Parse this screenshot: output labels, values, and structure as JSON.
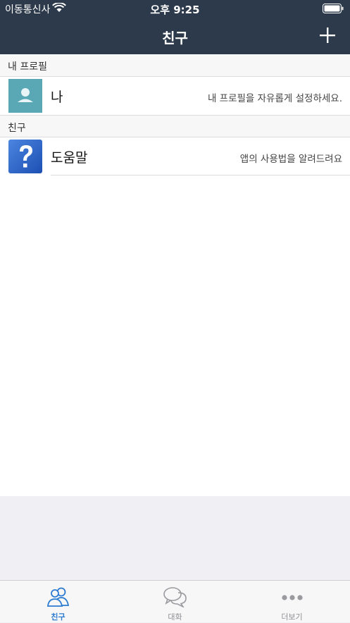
{
  "status_bar": {
    "carrier": "이동통신사",
    "time": "오후 9:25"
  },
  "nav": {
    "title": "친구",
    "add_icon": "plus-icon"
  },
  "sections": [
    {
      "header": "내 프로필"
    },
    {
      "header": "친구"
    }
  ],
  "my_profile": {
    "name": "나",
    "status": "내 프로필을 자유롭게 설정하세요.",
    "avatar_color": "#5aa7b5"
  },
  "friends": [
    {
      "name": "도움말",
      "status": "앱의 사용법을 알려드려요",
      "icon": "help-question-icon"
    }
  ],
  "tabs": [
    {
      "label": "친구",
      "icon": "friends-icon",
      "active": true
    },
    {
      "label": "대화",
      "icon": "chat-bubbles-icon",
      "active": false
    },
    {
      "label": "더보기",
      "icon": "more-dots-icon",
      "active": false
    }
  ],
  "colors": {
    "nav_bg": "#2d3a4b",
    "accent": "#2c7bd1",
    "inactive": "#8e8e93"
  }
}
